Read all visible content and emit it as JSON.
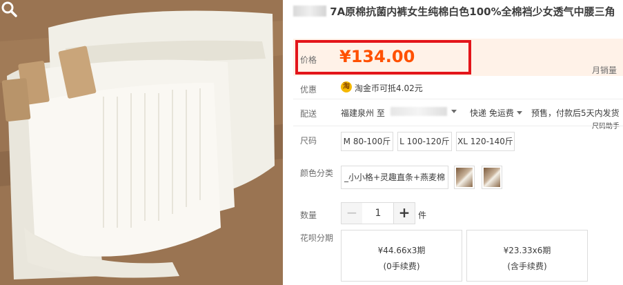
{
  "product": {
    "title": "7A原棉抗菌内裤女生纯棉白色100%全棉裆少女透气中腰三角"
  },
  "price": {
    "label": "价格",
    "value": "¥134.00"
  },
  "sales": {
    "label": "月销量"
  },
  "promo": {
    "label": "优惠",
    "coin_glyph": "淘",
    "text": "淘金币可抵4.02元"
  },
  "shipping": {
    "label": "配送",
    "origin": "福建泉州 至",
    "method": "快递 免运费",
    "presale": "预售，付款后5天内发货"
  },
  "size": {
    "label": "尺码",
    "helper": "尺码助手",
    "options": [
      "M 80-100斤",
      "L 100-120斤",
      "XL 120-140斤"
    ]
  },
  "color": {
    "label": "颜色分类",
    "selected_option": "_小小格+灵趣直条+燕麦棉"
  },
  "quantity": {
    "label": "数量",
    "value": "1",
    "minus": "−",
    "plus": "+",
    "unit": "件"
  },
  "installment": {
    "label": "花呗分期",
    "plans": [
      {
        "amount": "¥44.66x3期",
        "fee": "(0手续费)"
      },
      {
        "amount": "¥23.33x6期",
        "fee": "(含手续费)"
      }
    ]
  },
  "colors": {
    "price": "#ff5000",
    "highlight_border": "#e3151a",
    "price_bg": "#fff2e8"
  },
  "icons": {
    "zoom": "magnifier-icon",
    "coin": "taobao-coin-icon"
  }
}
